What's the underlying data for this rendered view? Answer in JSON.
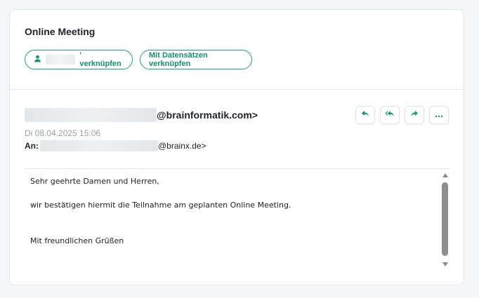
{
  "card": {
    "title": "Online Meeting",
    "link_button_label": "' verknüpfen",
    "link_records_label": "Mit Datensätzen verknüpfen"
  },
  "email": {
    "from_domain": "@brainformatik.com>",
    "date": "Di 08.04.2025 15:06",
    "to_label": "An:",
    "to_domain": "@brainx.de>",
    "body": {
      "greeting": "Sehr geehrte Damen und Herren,",
      "line1": "wir bestätigen hiermit die Teilnahme am geplanten Online Meeting.",
      "closing": "Mit freundlichen Grüßen"
    }
  },
  "colors": {
    "accent": "#1aa67c"
  },
  "icons": {
    "reply": "reply-icon",
    "reply_all": "reply-all-icon",
    "forward": "forward-icon",
    "more": "more-icon",
    "user": "user-icon"
  }
}
